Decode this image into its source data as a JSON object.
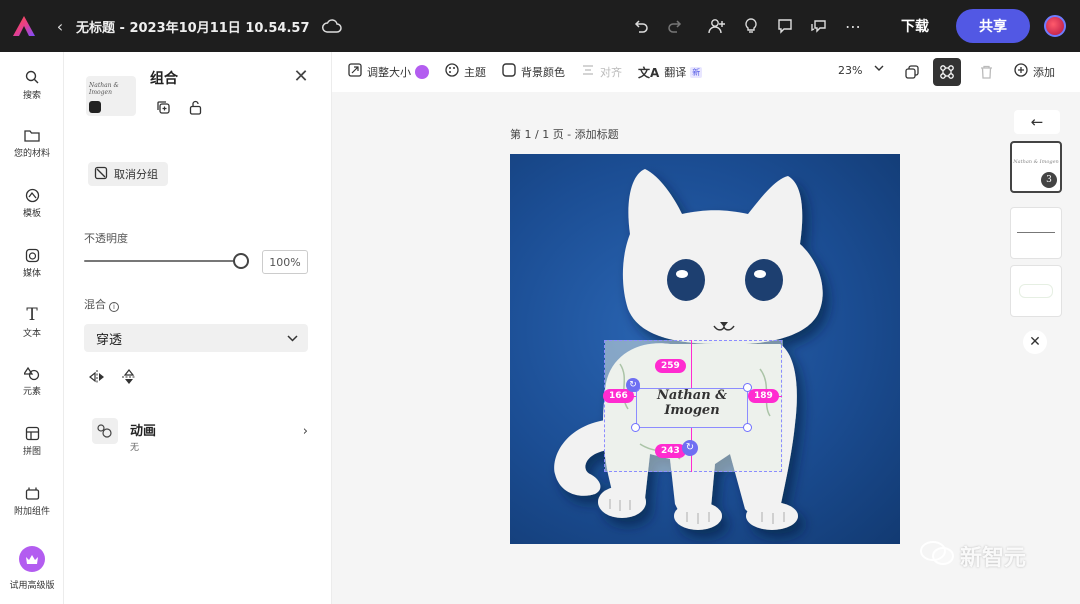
{
  "topbar": {
    "doc_title": "无标题 - 2023年10月11日 10.54.57",
    "download_label": "下载",
    "share_label": "共享"
  },
  "rail": {
    "items": [
      {
        "label": "搜索",
        "icon": "search-icon"
      },
      {
        "label": "您的材料",
        "icon": "folder-icon"
      },
      {
        "label": "模板",
        "icon": "template-icon"
      },
      {
        "label": "媒体",
        "icon": "media-icon"
      },
      {
        "label": "文本",
        "icon": "text-icon"
      },
      {
        "label": "元素",
        "icon": "shapes-icon"
      },
      {
        "label": "拼图",
        "icon": "grid-icon"
      },
      {
        "label": "附加组件",
        "icon": "addons-icon"
      },
      {
        "label": "试用高级版",
        "icon": "crown-icon"
      }
    ]
  },
  "panel": {
    "title": "组合",
    "thumb_text": "Nathan & Imogen",
    "ungroup_label": "取消分组",
    "opacity_label": "不透明度",
    "opacity_value": "100%",
    "opacity_fraction": 1.0,
    "blend_label": "混合",
    "blend_value": "穿透",
    "animation_title": "动画",
    "animation_value": "无"
  },
  "toolbar": {
    "resize_label": "调整大小",
    "theme_label": "主题",
    "bg_color_label": "背景颜色",
    "align_label": "对齐",
    "translate_label": "翻译",
    "translate_badge": "新",
    "zoom_value": "23%",
    "add_label": "添加"
  },
  "canvas": {
    "page_label": "第 1 / 1 页 - 添加标题",
    "card_text": "Nathan & Imogen",
    "measure_top": "259",
    "measure_left": "166",
    "measure_right": "189",
    "measure_bottom": "243"
  },
  "pages": {
    "page_count": "3",
    "thumb_text": "Nathan & Imogen"
  },
  "watermark": "新智元"
}
